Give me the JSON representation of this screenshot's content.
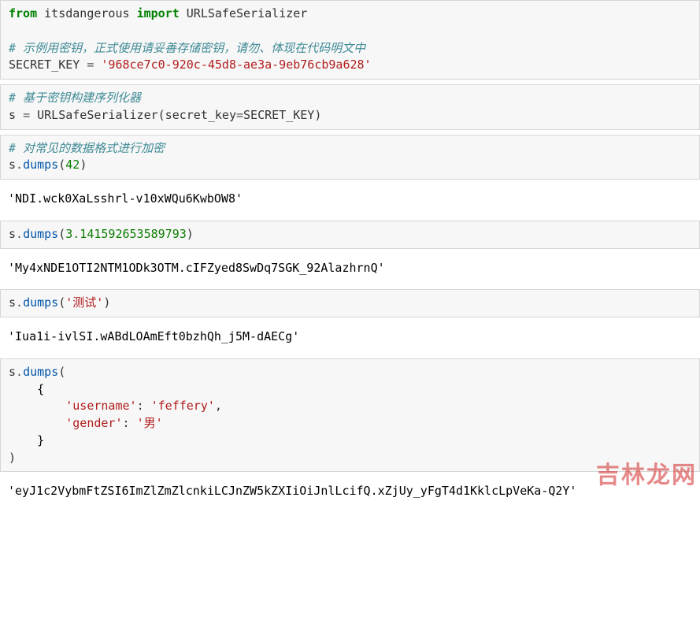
{
  "cells": [
    {
      "type": "code",
      "tokens": [
        {
          "cls": "kw",
          "t": "from"
        },
        {
          "cls": "nm",
          "t": " itsdangerous "
        },
        {
          "cls": "kw",
          "t": "import"
        },
        {
          "cls": "nm",
          "t": " URLSafeSerializer"
        },
        {
          "cls": "",
          "t": "\n\n"
        },
        {
          "cls": "comment",
          "t": "# 示例用密钥，正式使用请妥善存储密钥，请勿、体现在代码明文中"
        },
        {
          "cls": "",
          "t": "\n"
        },
        {
          "cls": "nm",
          "t": "SECRET_KEY "
        },
        {
          "cls": "op",
          "t": "="
        },
        {
          "cls": "nm",
          "t": " "
        },
        {
          "cls": "str",
          "t": "'968ce7c0-920c-45d8-ae3a-9eb76cb9a628'"
        }
      ]
    },
    {
      "type": "code",
      "tokens": [
        {
          "cls": "comment",
          "t": "# 基于密钥构建序列化器"
        },
        {
          "cls": "",
          "t": "\n"
        },
        {
          "cls": "nm",
          "t": "s "
        },
        {
          "cls": "op",
          "t": "="
        },
        {
          "cls": "nm",
          "t": " URLSafeSerializer(secret_key"
        },
        {
          "cls": "op",
          "t": "="
        },
        {
          "cls": "nm",
          "t": "SECRET_KEY)"
        }
      ]
    },
    {
      "type": "code",
      "tokens": [
        {
          "cls": "comment",
          "t": "# 对常见的数据格式进行加密"
        },
        {
          "cls": "",
          "t": "\n"
        },
        {
          "cls": "nm",
          "t": "s"
        },
        {
          "cls": "op",
          "t": "."
        },
        {
          "cls": "func",
          "t": "dumps"
        },
        {
          "cls": "nm",
          "t": "("
        },
        {
          "cls": "num",
          "t": "42"
        },
        {
          "cls": "nm",
          "t": ")"
        }
      ]
    },
    {
      "type": "output",
      "text": "'NDI.wck0XaLsshrl-v10xWQu6KwbOW8'"
    },
    {
      "type": "code",
      "tokens": [
        {
          "cls": "nm",
          "t": "s"
        },
        {
          "cls": "op",
          "t": "."
        },
        {
          "cls": "func",
          "t": "dumps"
        },
        {
          "cls": "nm",
          "t": "("
        },
        {
          "cls": "num",
          "t": "3.141592653589793"
        },
        {
          "cls": "nm",
          "t": ")"
        }
      ]
    },
    {
      "type": "output",
      "text": "'My4xNDE1OTI2NTM1ODk3OTM.cIFZyed8SwDq7SGK_92AlazhrnQ'"
    },
    {
      "type": "code",
      "tokens": [
        {
          "cls": "nm",
          "t": "s"
        },
        {
          "cls": "op",
          "t": "."
        },
        {
          "cls": "func",
          "t": "dumps"
        },
        {
          "cls": "nm",
          "t": "("
        },
        {
          "cls": "str",
          "t": "'测试'"
        },
        {
          "cls": "nm",
          "t": ")"
        }
      ]
    },
    {
      "type": "output",
      "text": "'Iua1i-ivlSI.wABdLOAmEft0bzhQh_j5M-dAECg'"
    },
    {
      "type": "code",
      "tokens": [
        {
          "cls": "nm",
          "t": "s"
        },
        {
          "cls": "op",
          "t": "."
        },
        {
          "cls": "func",
          "t": "dumps"
        },
        {
          "cls": "nm",
          "t": "("
        },
        {
          "cls": "",
          "t": "\n    {"
        },
        {
          "cls": "",
          "t": "\n        "
        },
        {
          "cls": "str",
          "t": "'username'"
        },
        {
          "cls": "nm",
          "t": ": "
        },
        {
          "cls": "str",
          "t": "'feffery'"
        },
        {
          "cls": "nm",
          "t": ","
        },
        {
          "cls": "",
          "t": "\n        "
        },
        {
          "cls": "str",
          "t": "'gender'"
        },
        {
          "cls": "nm",
          "t": ": "
        },
        {
          "cls": "str",
          "t": "'男'"
        },
        {
          "cls": "",
          "t": "\n    }"
        },
        {
          "cls": "",
          "t": "\n"
        },
        {
          "cls": "nm",
          "t": ")"
        }
      ]
    },
    {
      "type": "output",
      "text": "'eyJ1c2VybmFtZSI6ImZlZmZlcnkiLCJnZW5kZXIiOiJnlLcifQ.xZjUy_yFgT4d1KklcLpVeKa-Q2Y'"
    }
  ],
  "watermark": "吉林龙网"
}
